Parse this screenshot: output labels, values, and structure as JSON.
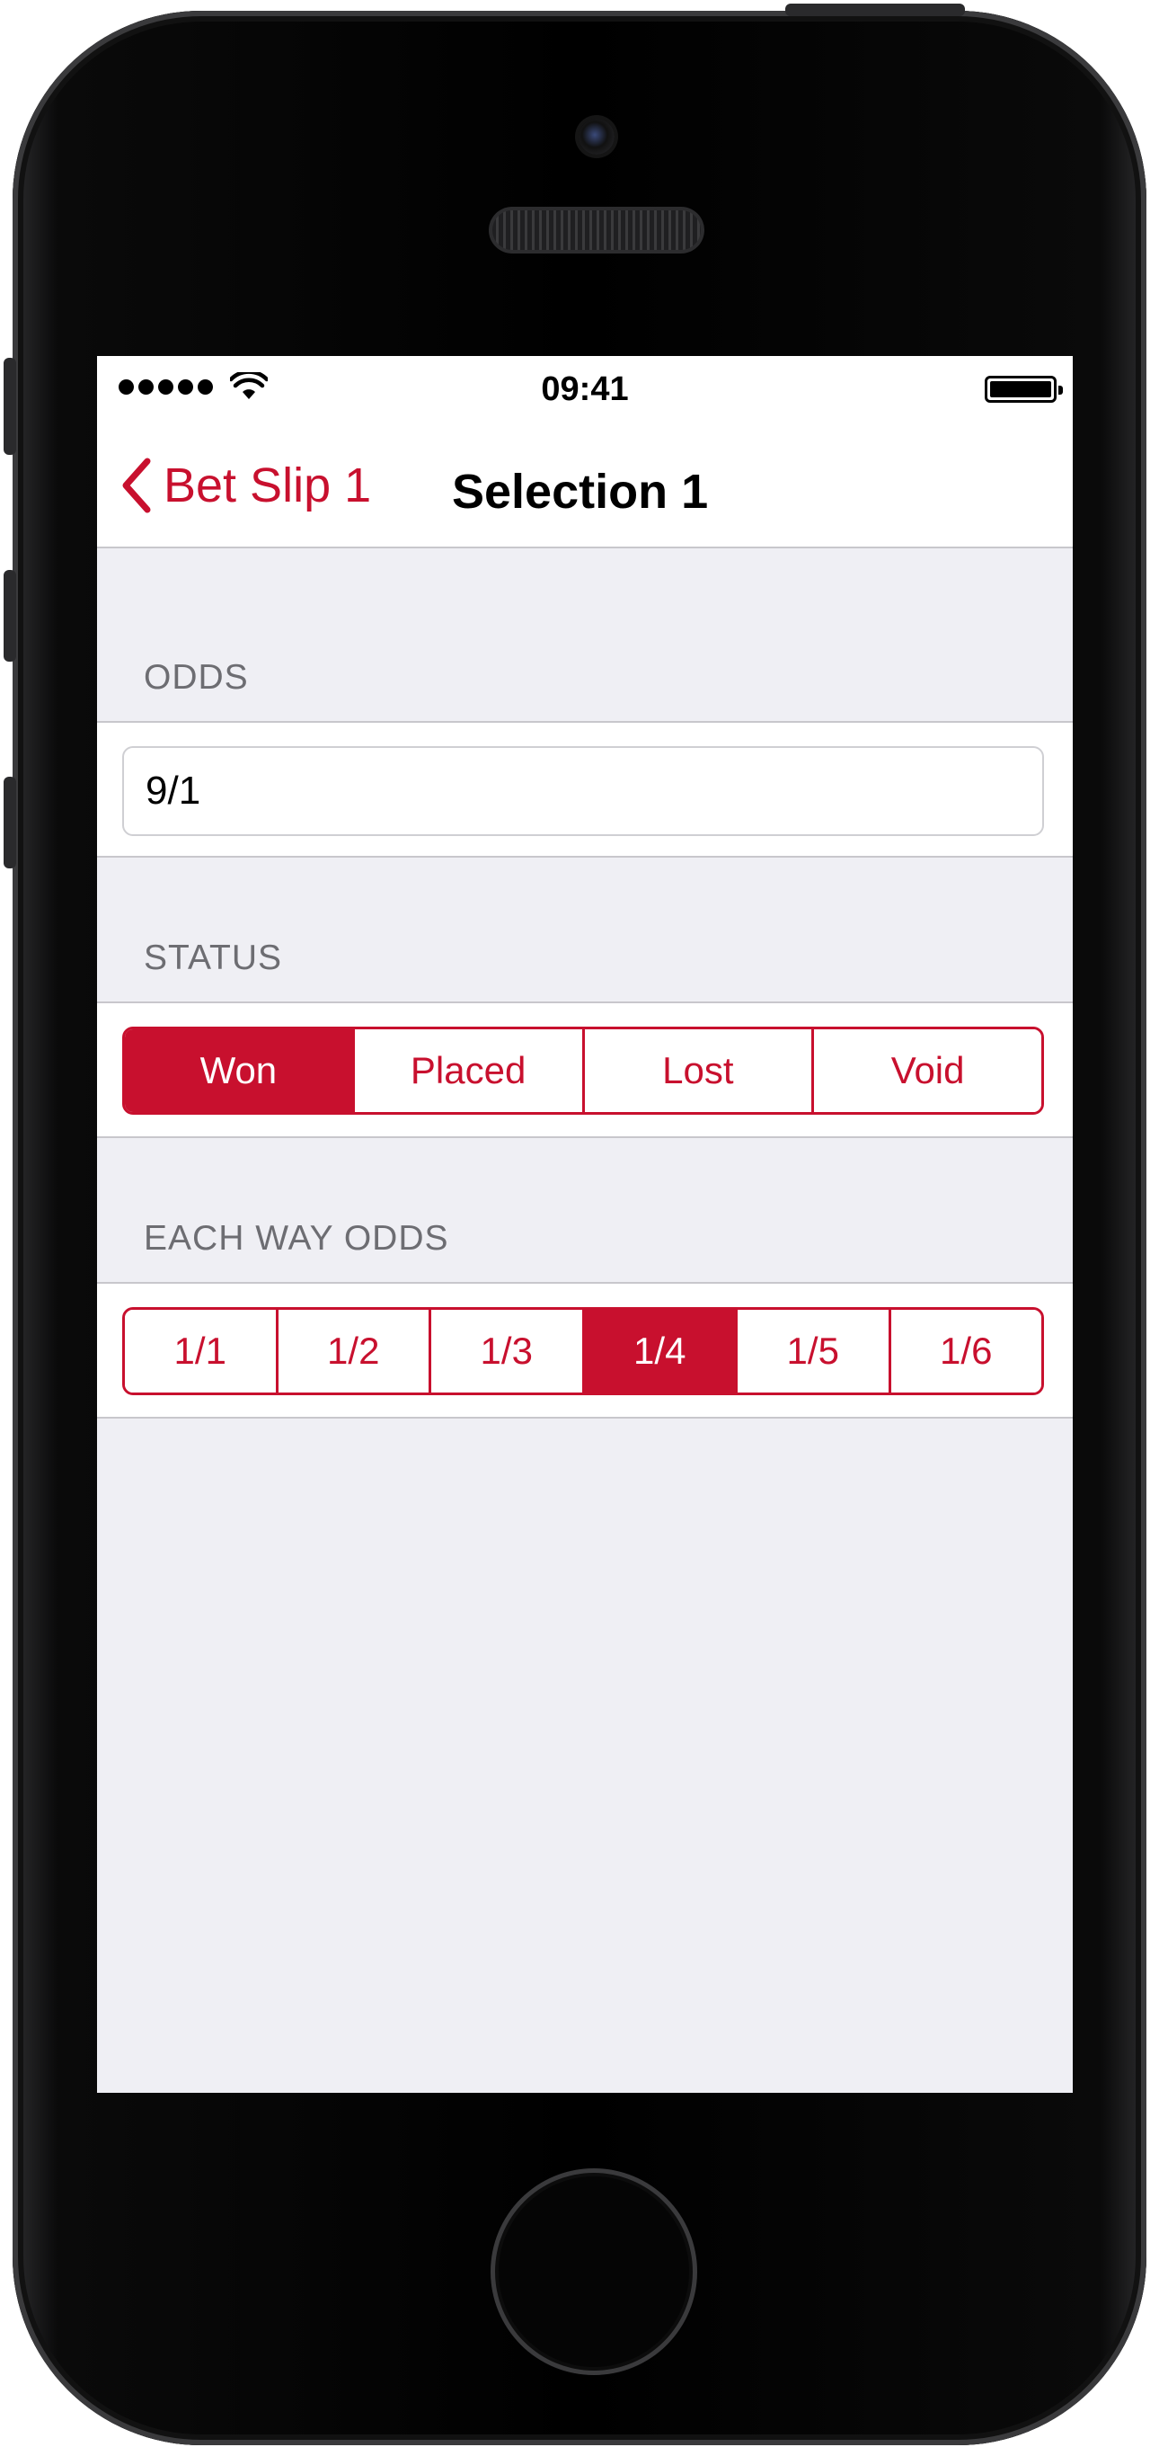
{
  "status_bar": {
    "time": "09:41"
  },
  "nav": {
    "back_label": "Bet Slip 1",
    "title": "Selection 1"
  },
  "odds": {
    "header": "ODDS",
    "value": "9/1"
  },
  "status": {
    "header": "STATUS",
    "options": [
      "Won",
      "Placed",
      "Lost",
      "Void"
    ],
    "selected": "Won"
  },
  "each_way": {
    "header": "EACH WAY ODDS",
    "options": [
      "1/1",
      "1/2",
      "1/3",
      "1/4",
      "1/5",
      "1/6"
    ],
    "selected": "1/4"
  },
  "colors": {
    "accent": "#c8102e",
    "background": "#efeff4",
    "section_header_text": "#6d6d72"
  },
  "icons": [
    "signal-dots-icon",
    "wifi-icon",
    "battery-icon",
    "chevron-left-icon"
  ]
}
